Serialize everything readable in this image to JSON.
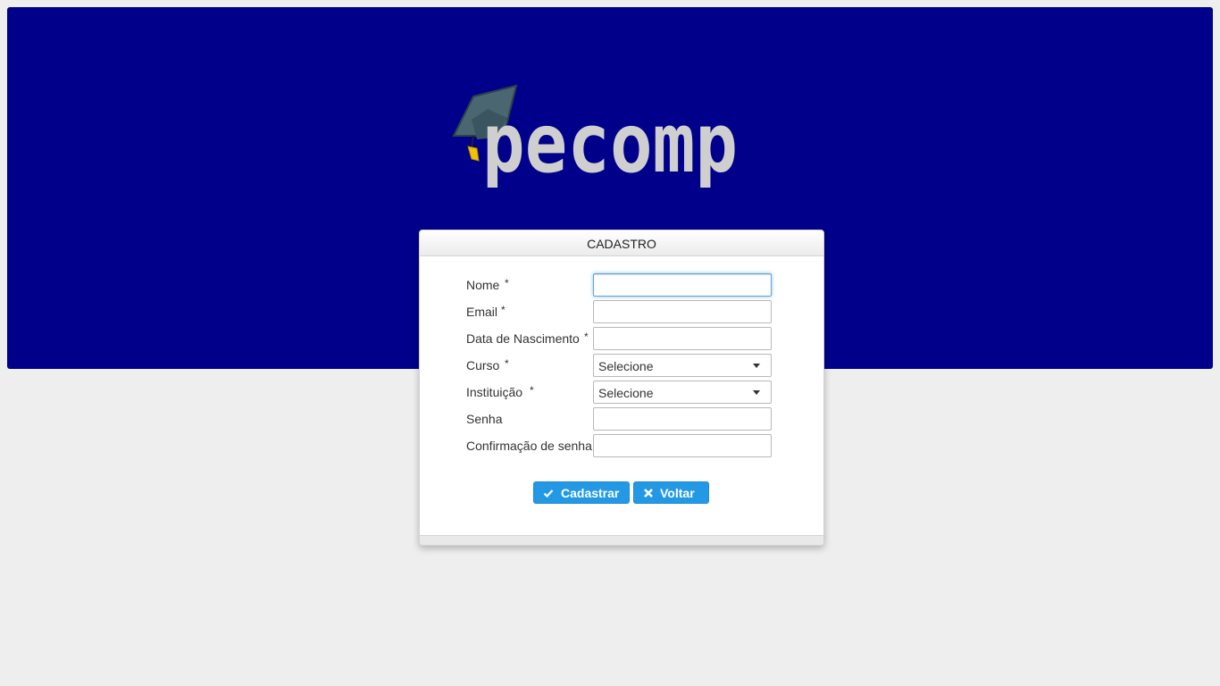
{
  "banner": {
    "logo_text": "pecomp",
    "colors": {
      "background": "#00008b",
      "logo_text": "#cfcfcf",
      "cap": "#4a6670",
      "tassel": "#f2c200"
    }
  },
  "form": {
    "title": "CADASTRO",
    "fields": [
      {
        "label": "Nome",
        "required_mark": "*",
        "type": "text",
        "value": "",
        "focused": true
      },
      {
        "label": "Email",
        "required_mark": "*",
        "type": "text",
        "value": ""
      },
      {
        "label": "Data de Nascimento",
        "required_mark": "*",
        "type": "text",
        "value": ""
      },
      {
        "label": "Curso",
        "required_mark": "*",
        "type": "select",
        "value": "Selecione"
      },
      {
        "label": "Instituição",
        "required_mark": "*",
        "type": "select",
        "value": "Selecione"
      },
      {
        "label": "Senha",
        "required_mark": "",
        "type": "password",
        "value": ""
      },
      {
        "label": "Confirmação de senha",
        "required_mark": "",
        "type": "password",
        "value": ""
      }
    ],
    "buttons": {
      "submit": {
        "label": "Cadastrar",
        "icon": "check-icon"
      },
      "back": {
        "label": "Voltar",
        "icon": "close-icon"
      }
    },
    "colors": {
      "button": "#2399e5",
      "focus_ring": "#8dc3e6"
    }
  }
}
